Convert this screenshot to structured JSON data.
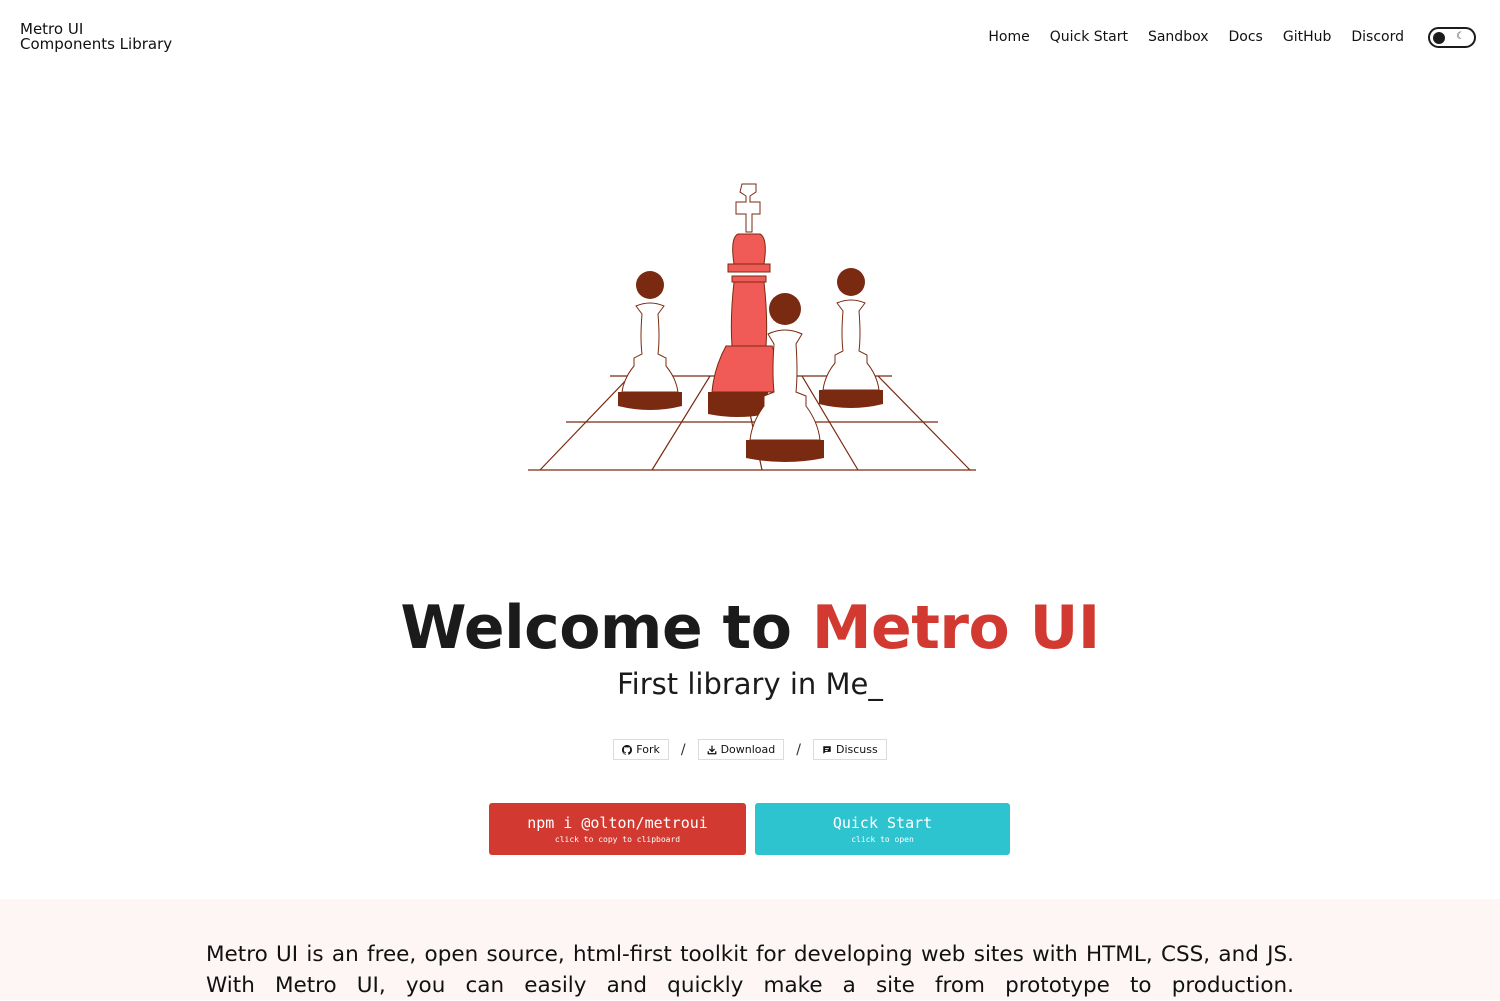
{
  "brand": {
    "line1": "Metro UI",
    "line2": "Components Library"
  },
  "nav": {
    "items": [
      "Home",
      "Quick Start",
      "Sandbox",
      "Docs",
      "GitHub",
      "Discord"
    ]
  },
  "theme_toggle": {
    "icon": "moon-icon",
    "mode": "dark"
  },
  "hero": {
    "title_prefix": "Welcome to ",
    "title_accent": "Metro UI",
    "subtitle": "First library in Me_",
    "art": "chess-pieces-illustration"
  },
  "chips": [
    {
      "label": "Fork",
      "icon": "github-icon"
    },
    {
      "label": "Download",
      "icon": "download-icon"
    },
    {
      "label": "Discuss",
      "icon": "chat-icon"
    }
  ],
  "chip_separator": "/",
  "cta": {
    "npm": {
      "label": "npm i @olton/metroui",
      "hint": "click to copy to clipboard"
    },
    "quick_start": {
      "label": "Quick Start",
      "hint": "click to open"
    }
  },
  "intro": {
    "text": "Metro UI is an free, open source, html-first toolkit for developing web sites with HTML, CSS, and JS. With Metro UI, you can easily and quickly make a site from prototype to production."
  },
  "colors": {
    "accent_red": "#d23a31",
    "accent_cyan": "#2dc3cf",
    "piece_red": "#f05a57",
    "piece_brown": "#7a2a10",
    "intro_bg": "#fdf6f5"
  }
}
